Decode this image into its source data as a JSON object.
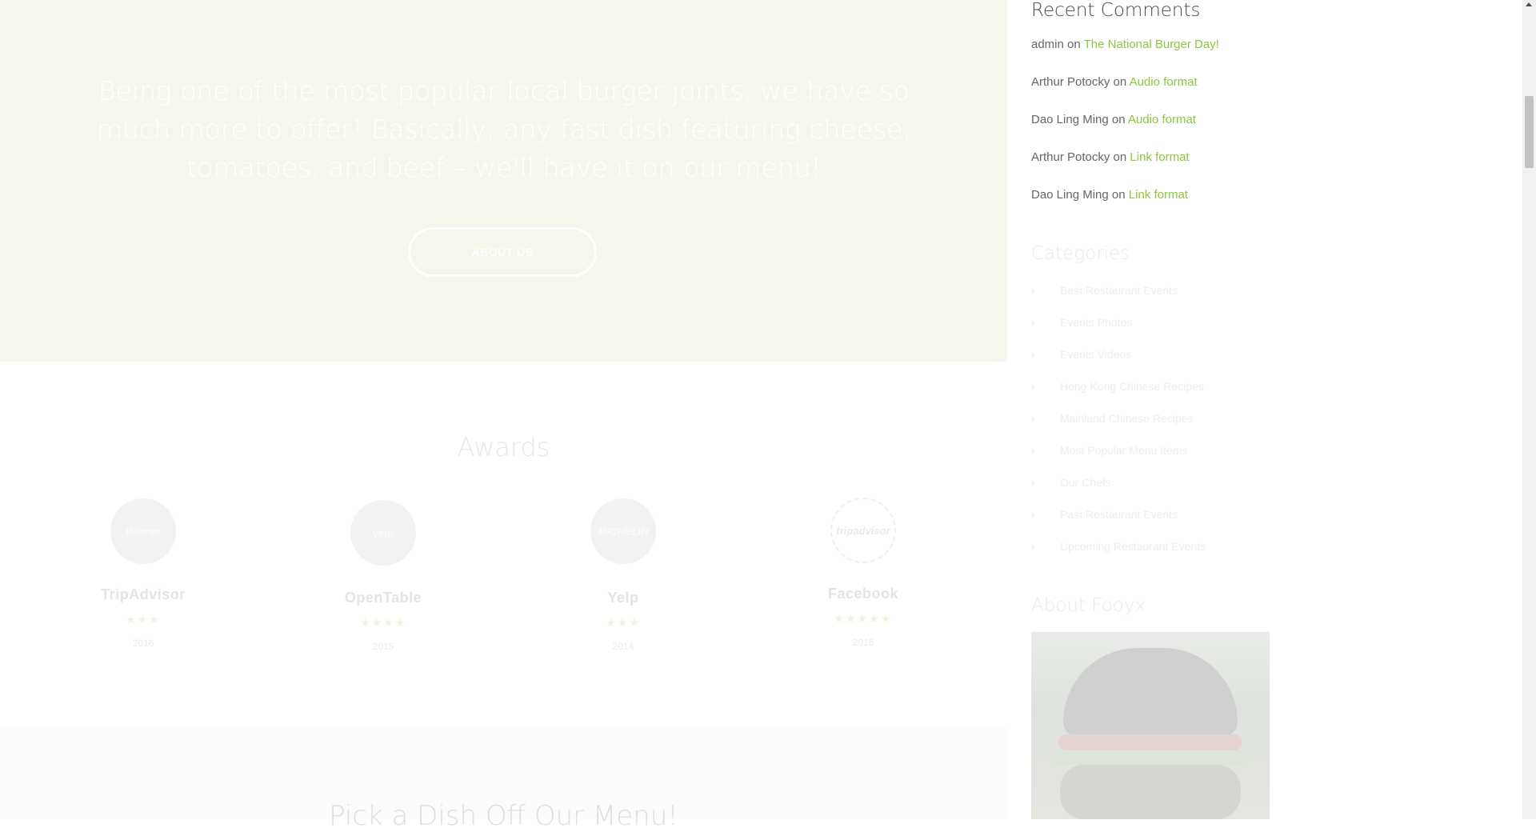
{
  "hero": {
    "text": "Being one of the most popular local burger joints, we have so much more to offer! Basically, any fast dish featuring cheese, tomatoes, and beef – we'll have it on our menu!",
    "button_label": "ABOUT US"
  },
  "awards": {
    "title": "Awards",
    "items": [
      {
        "badge": "Winner",
        "name": "TripAdvisor",
        "stars": "★★★",
        "year": "2016"
      },
      {
        "badge": "yelp",
        "name": "OpenTable",
        "stars": "★★★★",
        "year": "2015"
      },
      {
        "badge": "MICHELIN",
        "name": "Yelp",
        "stars": "★★★",
        "year": "2014"
      },
      {
        "badge": "tripadvisor",
        "name": "Facebook",
        "stars": "★★★★★",
        "year": "2016"
      }
    ]
  },
  "menu_section": {
    "title": "Pick a Dish Off Our Menu!"
  },
  "sidebar": {
    "recent_comments": {
      "title": "Recent Comments",
      "items": [
        {
          "author": "admin",
          "on": "on",
          "post": "The National Burger Day!"
        },
        {
          "author": "Arthur Potocky",
          "on": "on",
          "post": "Audio format"
        },
        {
          "author": "Dao Ling Ming",
          "on": "on",
          "post": "Audio format"
        },
        {
          "author": "Arthur Potocky",
          "on": "on",
          "post": "Link format"
        },
        {
          "author": "Dao Ling Ming",
          "on": "on",
          "post": "Link format"
        }
      ]
    },
    "categories": {
      "title": "Categories",
      "items": [
        "Best Restaurant Events",
        "Events Photos",
        "Events Videos",
        "Hong Kong Chinese Recipes",
        "Mainland Chinese Recipes",
        "Most Popular Menu Items",
        "Our Chefs",
        "Past Restaurant Events",
        "Upcoming Restaurant Events"
      ]
    },
    "about": {
      "title": "About Fooyx"
    }
  },
  "colors": {
    "accent": "#8dc63f",
    "hero_bg": "#f4f7ec"
  }
}
